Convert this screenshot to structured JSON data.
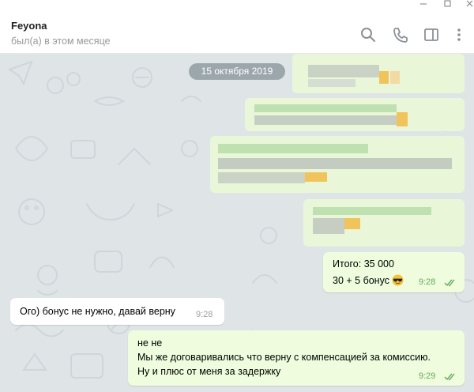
{
  "header": {
    "name": "Feyona",
    "status": "был(а) в этом месяце"
  },
  "date_separator": "15 октября 2019",
  "messages": [
    {
      "lines": [
        "Итого: 35 000",
        "30 + 5 бонус"
      ],
      "time": "9:28",
      "emoji": "sunglasses-emoji"
    },
    {
      "lines": [
        "Ого) бонус не нужно, давай верну"
      ],
      "time": "9:28"
    },
    {
      "lines": [
        "не не",
        "Мы же договаривались что верну с компенсацией за комиссию.",
        "Ну и плюс от меня за задержку"
      ],
      "time": "9:29"
    }
  ],
  "colors": {
    "outgoing_bubble": "#effdde",
    "incoming_bubble": "#ffffff",
    "chat_background": "#dfe4e7",
    "read_check": "#62a85b"
  }
}
